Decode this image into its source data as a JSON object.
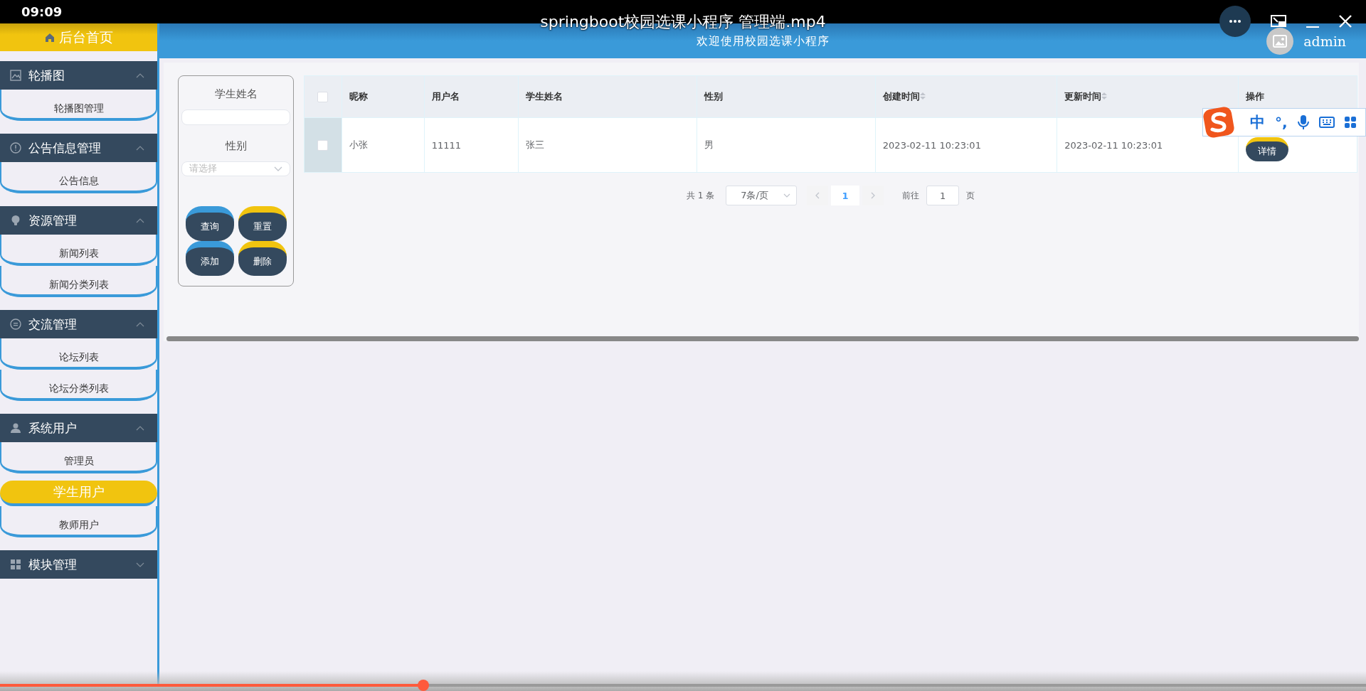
{
  "player": {
    "time": "09:09",
    "title": "springboot校园选课小程序 管理端.mp4",
    "progress": {
      "level": 0.31
    }
  },
  "header": {
    "home": "后台首页",
    "welcome": "欢迎使用校园选课小程序",
    "user": "admin"
  },
  "sidebar": [
    {
      "title": "轮播图",
      "kind": "image",
      "expanded": true,
      "items": [
        {
          "label": "轮播图管理",
          "selected": false
        }
      ]
    },
    {
      "title": "公告信息管理",
      "kind": "info",
      "expanded": true,
      "items": [
        {
          "label": "公告信息",
          "selected": false
        }
      ]
    },
    {
      "title": "资源管理",
      "kind": "bulb",
      "expanded": true,
      "items": [
        {
          "label": "新闻列表",
          "selected": false
        },
        {
          "label": "新闻分类列表",
          "selected": false
        }
      ]
    },
    {
      "title": "交流管理",
      "kind": "chat",
      "expanded": true,
      "items": [
        {
          "label": "论坛列表",
          "selected": false
        },
        {
          "label": "论坛分类列表",
          "selected": false
        }
      ]
    },
    {
      "title": "系统用户",
      "kind": "user",
      "expanded": true,
      "items": [
        {
          "label": "管理员",
          "selected": false
        },
        {
          "label": "学生用户",
          "selected": true
        },
        {
          "label": "教师用户",
          "selected": false
        }
      ]
    },
    {
      "title": "模块管理",
      "kind": "grid",
      "expanded": false
    }
  ],
  "search": {
    "fields": [
      {
        "label": "学生姓名",
        "kind": "text"
      },
      {
        "label": "性别",
        "kind": "select",
        "placeholder": "请选择"
      }
    ],
    "buttons": [
      {
        "label": "查询",
        "color": "#3a9ad9"
      },
      {
        "label": "重置",
        "color": "#f1c40f"
      },
      {
        "label": "添加",
        "color": "#3a9ad9"
      },
      {
        "label": "删除",
        "color": "#f1c40f"
      }
    ]
  },
  "table": {
    "all_checked": false,
    "columns": [
      {
        "label": "昵称",
        "sortable": false
      },
      {
        "label": "用户名",
        "sortable": false
      },
      {
        "label": "学生姓名",
        "sortable": false
      },
      {
        "label": "性别",
        "sortable": false
      },
      {
        "label": "创建时间",
        "sortable": true
      },
      {
        "label": "更新时间",
        "sortable": true
      },
      {
        "label": "操作",
        "sortable": false
      }
    ],
    "rows": [
      {
        "checked": false,
        "cells": [
          "小张",
          "11111",
          "张三",
          "男",
          "2023-02-11 10:23:01",
          "2023-02-11 10:23:01"
        ],
        "action": "详情"
      }
    ]
  },
  "pagination": {
    "total": "共 1 条",
    "page_size": "7条/页",
    "pages": [
      {
        "label": "1",
        "selected": true
      }
    ],
    "goto_label": "前往",
    "goto_value": "1",
    "page_unit": "页"
  },
  "ime": {
    "mode": "中",
    "punctuation": "°,"
  }
}
